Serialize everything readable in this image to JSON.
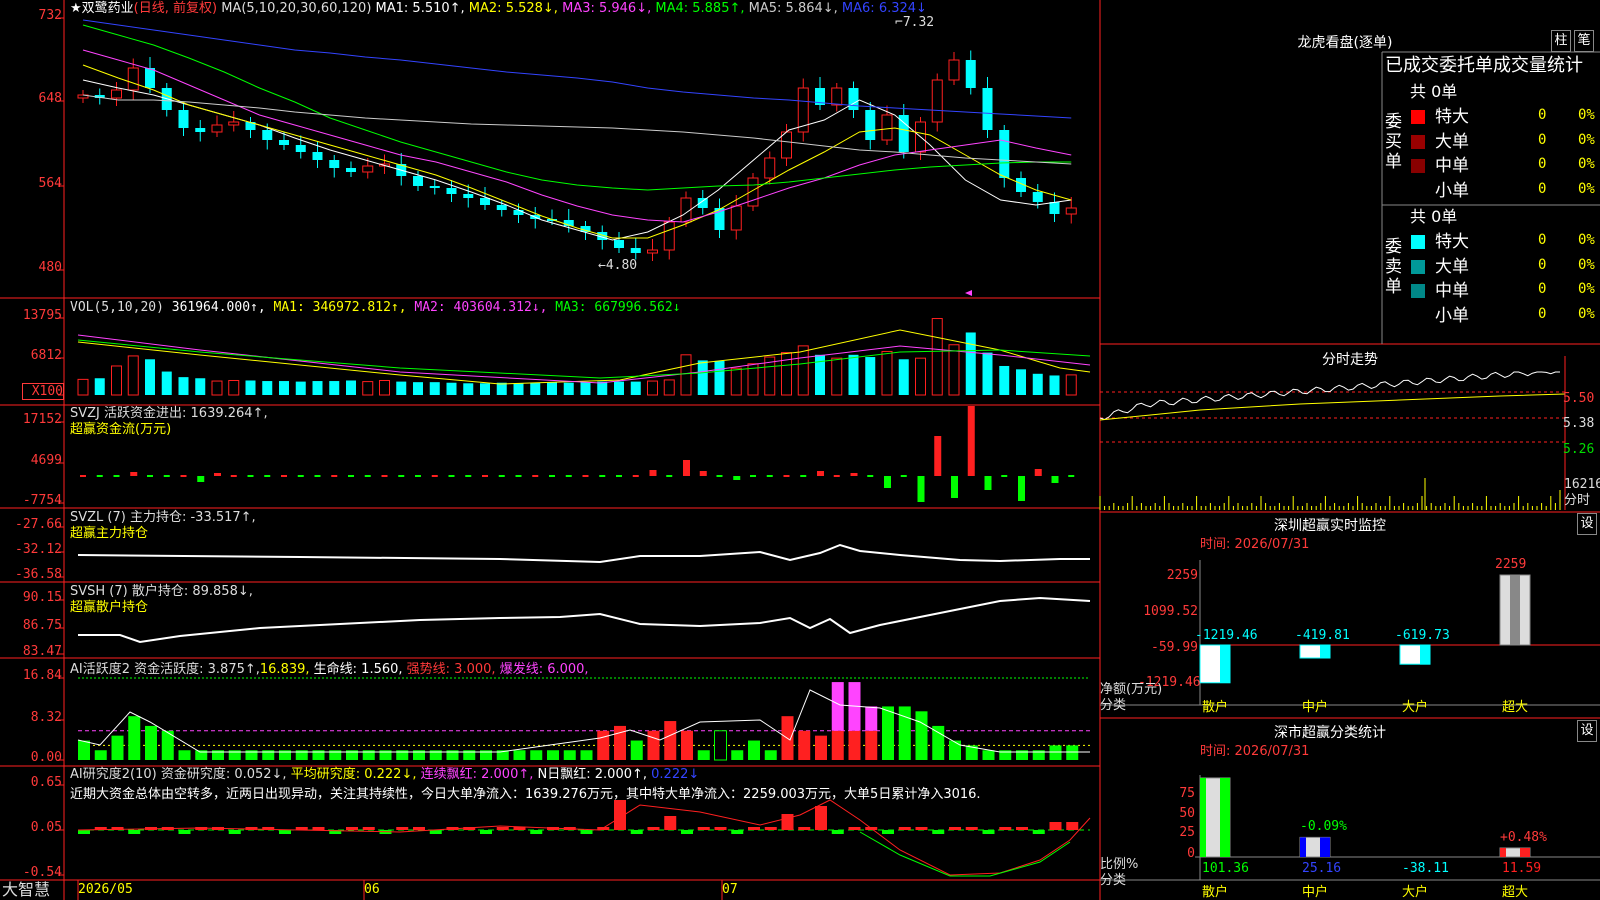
{
  "stock": {
    "title": "★双鹭药业",
    "period": "(日线, 前复权)",
    "ma_header": "MA(5,10,20,30,60,120)",
    "ma_values": [
      {
        "label": "MA1: 5.510↑,",
        "color": "#ffffff"
      },
      {
        "label": "MA2: 5.528↓,",
        "color": "#ffff00"
      },
      {
        "label": "MA3: 5.946↓,",
        "color": "#ff44ff"
      },
      {
        "label": "MA4: 5.885↑,",
        "color": "#00ff00"
      },
      {
        "label": "MA5: 5.864↓,",
        "color": "#cccccc"
      },
      {
        "label": "MA6: 6.324↓",
        "color": "#3344ff"
      }
    ],
    "high_label": "7.32",
    "low_label": "4.80",
    "y_ticks": [
      "732",
      "648",
      "564",
      "480"
    ]
  },
  "vol": {
    "header": "VOL(5,10,20)",
    "value": "361964.000↑,",
    "ma1": "MA1: 346972.812↑,",
    "ma2": "MA2: 403604.312↓,",
    "ma3": "MA3: 667996.562↓",
    "y_ticks": [
      "13795",
      "6812",
      "X100"
    ]
  },
  "svzj": {
    "header": "SVZJ  活跃资金进出: 1639.264↑,",
    "sub": "超赢资金流(万元)",
    "y_ticks": [
      "17152",
      "4699",
      "-7754"
    ]
  },
  "svzl": {
    "header": "SVZL (7) 主力持仓: -33.517↑,",
    "sub": "超赢主力持仓",
    "y_ticks": [
      "-27.66",
      "-32.12",
      "-36.58"
    ]
  },
  "svsh": {
    "header": "SVSH (7) 散户持仓: 89.858↓,",
    "sub": "超赢散户持仓",
    "y_ticks": [
      "90.15",
      "86.75",
      "83.47"
    ]
  },
  "ai2": {
    "header_a": "AI活跃度2 资金活跃度: 3.875↑,",
    "header_b": "16.839,",
    "header_c": "生命线: 1.560,",
    "header_d": "强势线: 3.000,",
    "header_e": "爆发线: 6.000,",
    "y_ticks": [
      "16.84",
      "8.32",
      "0.00"
    ]
  },
  "ai_research": {
    "header_a": "AI研究度2(10) 资金研究度: 0.052↓,",
    "header_b": "平均研究度: 0.222↓,",
    "header_c": "连续飘红: 2.000↑,",
    "header_d": "N日飘红: 2.000↑,",
    "header_e": "0.222↓",
    "comment": "近期大资金总体由空转多，近两日出现异动，关注其持续性，今日大单净流入：1639.276万元，其中特大单净流入：2259.003万元，大单5日累计净入3016.",
    "y_ticks": [
      "0.65",
      "0.05",
      "-0.54"
    ]
  },
  "x_axis": {
    "brand": "大智慧",
    "labels": [
      "2026/05",
      "06",
      "07"
    ]
  },
  "lhb": {
    "title": "龙虎看盘(逐单)",
    "btn1": "柱",
    "btn2": "笔",
    "section_title": "已成交委托单成交量统计",
    "buy": {
      "side_label": "委买单",
      "total": "共 0单",
      "rows": [
        {
          "name": "特大",
          "count": "0",
          "pct": "0%",
          "color": "#ff0000"
        },
        {
          "name": "大单",
          "count": "0",
          "pct": "0%",
          "color": "#990000"
        },
        {
          "name": "中单",
          "count": "0",
          "pct": "0%",
          "color": "#880000"
        },
        {
          "name": "小单",
          "count": "0",
          "pct": "0%",
          "color": "#000000"
        }
      ]
    },
    "sell": {
      "side_label": "委卖单",
      "total": "共 0单",
      "rows": [
        {
          "name": "特大",
          "count": "0",
          "pct": "0%",
          "color": "#00ffff"
        },
        {
          "name": "大单",
          "count": "0",
          "pct": "0%",
          "color": "#009999"
        },
        {
          "name": "中单",
          "count": "0",
          "pct": "0%",
          "color": "#008888"
        },
        {
          "name": "小单",
          "count": "0",
          "pct": "0%",
          "color": "#000000"
        }
      ]
    }
  },
  "fenshi": {
    "title": "分时走势",
    "y_ticks": [
      "5.50",
      "5.38",
      "5.26"
    ],
    "vol_label": "16216",
    "vol_unit": "分时"
  },
  "monitor": {
    "title": "深圳超赢实时监控",
    "settings": "设",
    "time": "时间: 2026/07/31",
    "y_ticks": [
      "2259",
      "1099.52",
      "-59.99",
      "-1219.46"
    ],
    "y_label1": "净额(万元)",
    "y_label2": "分类",
    "bars": [
      {
        "cat": "散户",
        "value": -1219.46,
        "label": "-1219.46"
      },
      {
        "cat": "中户",
        "value": -419.81,
        "label": "-419.81"
      },
      {
        "cat": "大户",
        "value": -619.73,
        "label": "-619.73"
      },
      {
        "cat": "超大",
        "value": 2259,
        "label": "2259"
      }
    ]
  },
  "classify": {
    "title": "深市超赢分类统计",
    "settings": "设",
    "time": "时间: 2026/07/31",
    "y_ticks": [
      "75",
      "50",
      "25",
      "0"
    ],
    "y_label1": "比例%",
    "y_label2": "分类",
    "bars": [
      {
        "cat": "散户",
        "value": 101.36,
        "label": "101.36",
        "top_label": ""
      },
      {
        "cat": "中户",
        "value": 25.16,
        "label": "25.16",
        "top_label": "-0.09%"
      },
      {
        "cat": "大户",
        "value": -38.11,
        "label": "-38.11",
        "top_label": ""
      },
      {
        "cat": "超大",
        "value": 11.59,
        "label": "11.59",
        "top_label": "+0.48%"
      }
    ]
  }
}
